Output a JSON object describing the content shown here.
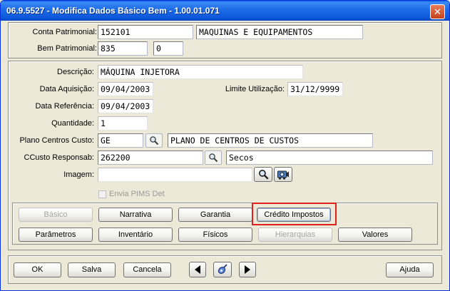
{
  "window": {
    "title": "06.9.5527 - Modifica Dados Básico Bem - 1.00.01.071",
    "close_glyph": "✕"
  },
  "header": {
    "conta_label": "Conta Patrimonial:",
    "conta_code": "152101",
    "conta_desc": "MAQUINAS E EQUIPAMENTOS",
    "bem_label": "Bem Patrimonial:",
    "bem_code": "835",
    "bem_seq": "0"
  },
  "form": {
    "descricao_label": "Descrição:",
    "descricao_value": "MÁQUINA INJETORA",
    "data_aquisicao_label": "Data Aquisição:",
    "data_aquisicao_value": "09/04/2003",
    "limite_label": "Limite Utilização:",
    "limite_value": "31/12/9999",
    "data_referencia_label": "Data Referência:",
    "data_referencia_value": "09/04/2003",
    "quantidade_label": "Quantidade:",
    "quantidade_value": "1",
    "plano_label": "Plano Centros Custo:",
    "plano_code": "GE",
    "plano_desc": "PLANO DE CENTROS DE CUSTOS",
    "ccusto_label": "CCusto Responsab:",
    "ccusto_code": "262200",
    "ccusto_desc": "Secos",
    "imagem_label": "Imagem:",
    "imagem_value": "",
    "envia_pims_label": "Envia PIMS Det"
  },
  "tabs_row1": [
    "Básico",
    "Narrativa",
    "Garantia",
    "Crédito Impostos"
  ],
  "tabs_row2": [
    "Parâmetros",
    "Inventário",
    "Físicos",
    "Hierarquias",
    "Valores"
  ],
  "footer": {
    "ok": "OK",
    "salva": "Salva",
    "cancela": "Cancela",
    "ajuda": "Ajuda"
  },
  "colors": {
    "highlight": "#e0211b",
    "titlebar": "#0c56d9"
  }
}
